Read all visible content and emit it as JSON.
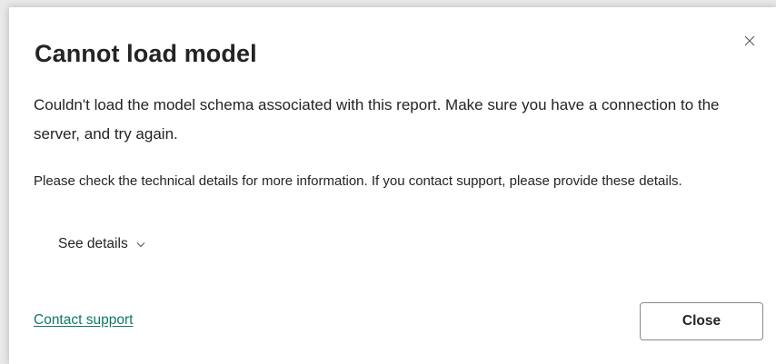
{
  "dialog": {
    "title": "Cannot load model",
    "message": "Couldn't load the model schema associated with this report. Make sure you have a connection to the server, and try again.",
    "details_text": "Please check the technical details for more information. If you contact support, please provide these details.",
    "see_details_label": "See details",
    "contact_support_label": "Contact support",
    "close_button_label": "Close"
  },
  "icons": {
    "dismiss": "close-icon",
    "expand": "chevron-down-icon"
  },
  "colors": {
    "text": "#252423",
    "link": "#117865",
    "border": "#8a8886"
  }
}
